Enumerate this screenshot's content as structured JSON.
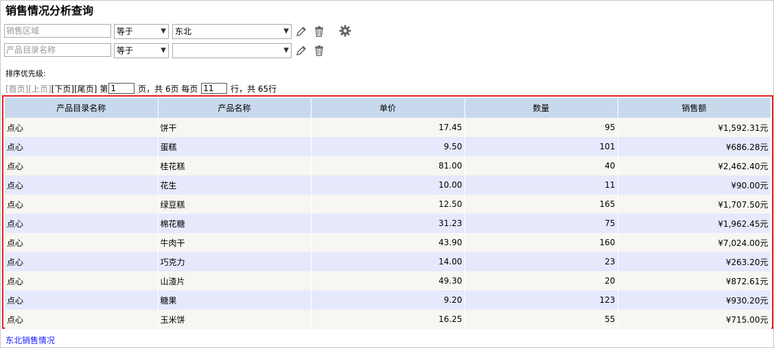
{
  "title": "销售情况分析查询",
  "filters": [
    {
      "field_placeholder": "销售区域",
      "operator": "等于",
      "value": "东北",
      "edit_icon": "pencil-icon",
      "delete_icon": "trash-icon"
    },
    {
      "field_placeholder": "产品目录名称",
      "operator": "等于",
      "value": "",
      "edit_icon": "pencil-icon",
      "delete_icon": "trash-icon"
    }
  ],
  "settings_icon": "gear-icon",
  "sort_label": "排序优先级:",
  "pager": {
    "first": "[首页]",
    "prev": "[上页]",
    "next": "[下页]",
    "last": "[尾页]",
    "page_prefix": "第",
    "page_value": "1",
    "page_suffix": "页，共 6页 每页",
    "rows_value": "11",
    "rows_suffix": "行，共 65行"
  },
  "table": {
    "headers": [
      "产品目录名称",
      "产品名称",
      "单价",
      "数量",
      "销售额"
    ],
    "rows": [
      [
        "点心",
        "饼干",
        "17.45",
        "95",
        "¥1,592.31元"
      ],
      [
        "点心",
        "蛋糕",
        "9.50",
        "101",
        "¥686.28元"
      ],
      [
        "点心",
        "桂花糕",
        "81.00",
        "40",
        "¥2,462.40元"
      ],
      [
        "点心",
        "花生",
        "10.00",
        "11",
        "¥90.00元"
      ],
      [
        "点心",
        "绿豆糕",
        "12.50",
        "165",
        "¥1,707.50元"
      ],
      [
        "点心",
        "棉花糖",
        "31.23",
        "75",
        "¥1,962.45元"
      ],
      [
        "点心",
        "牛肉干",
        "43.90",
        "160",
        "¥7,024.00元"
      ],
      [
        "点心",
        "巧克力",
        "14.00",
        "23",
        "¥263.20元"
      ],
      [
        "点心",
        "山渣片",
        "49.30",
        "20",
        "¥872.61元"
      ],
      [
        "点心",
        "糖果",
        "9.20",
        "123",
        "¥930.20元"
      ],
      [
        "点心",
        "玉米饼",
        "16.25",
        "55",
        "¥715.00元"
      ]
    ]
  },
  "footer_link": "东北销售情况",
  "colors": {
    "header_bg": "#c9d9ed",
    "row_odd": "#f7f6f2",
    "row_even": "#e5e9fb",
    "highlight_border": "#e02020",
    "link": "#1a1aff"
  }
}
